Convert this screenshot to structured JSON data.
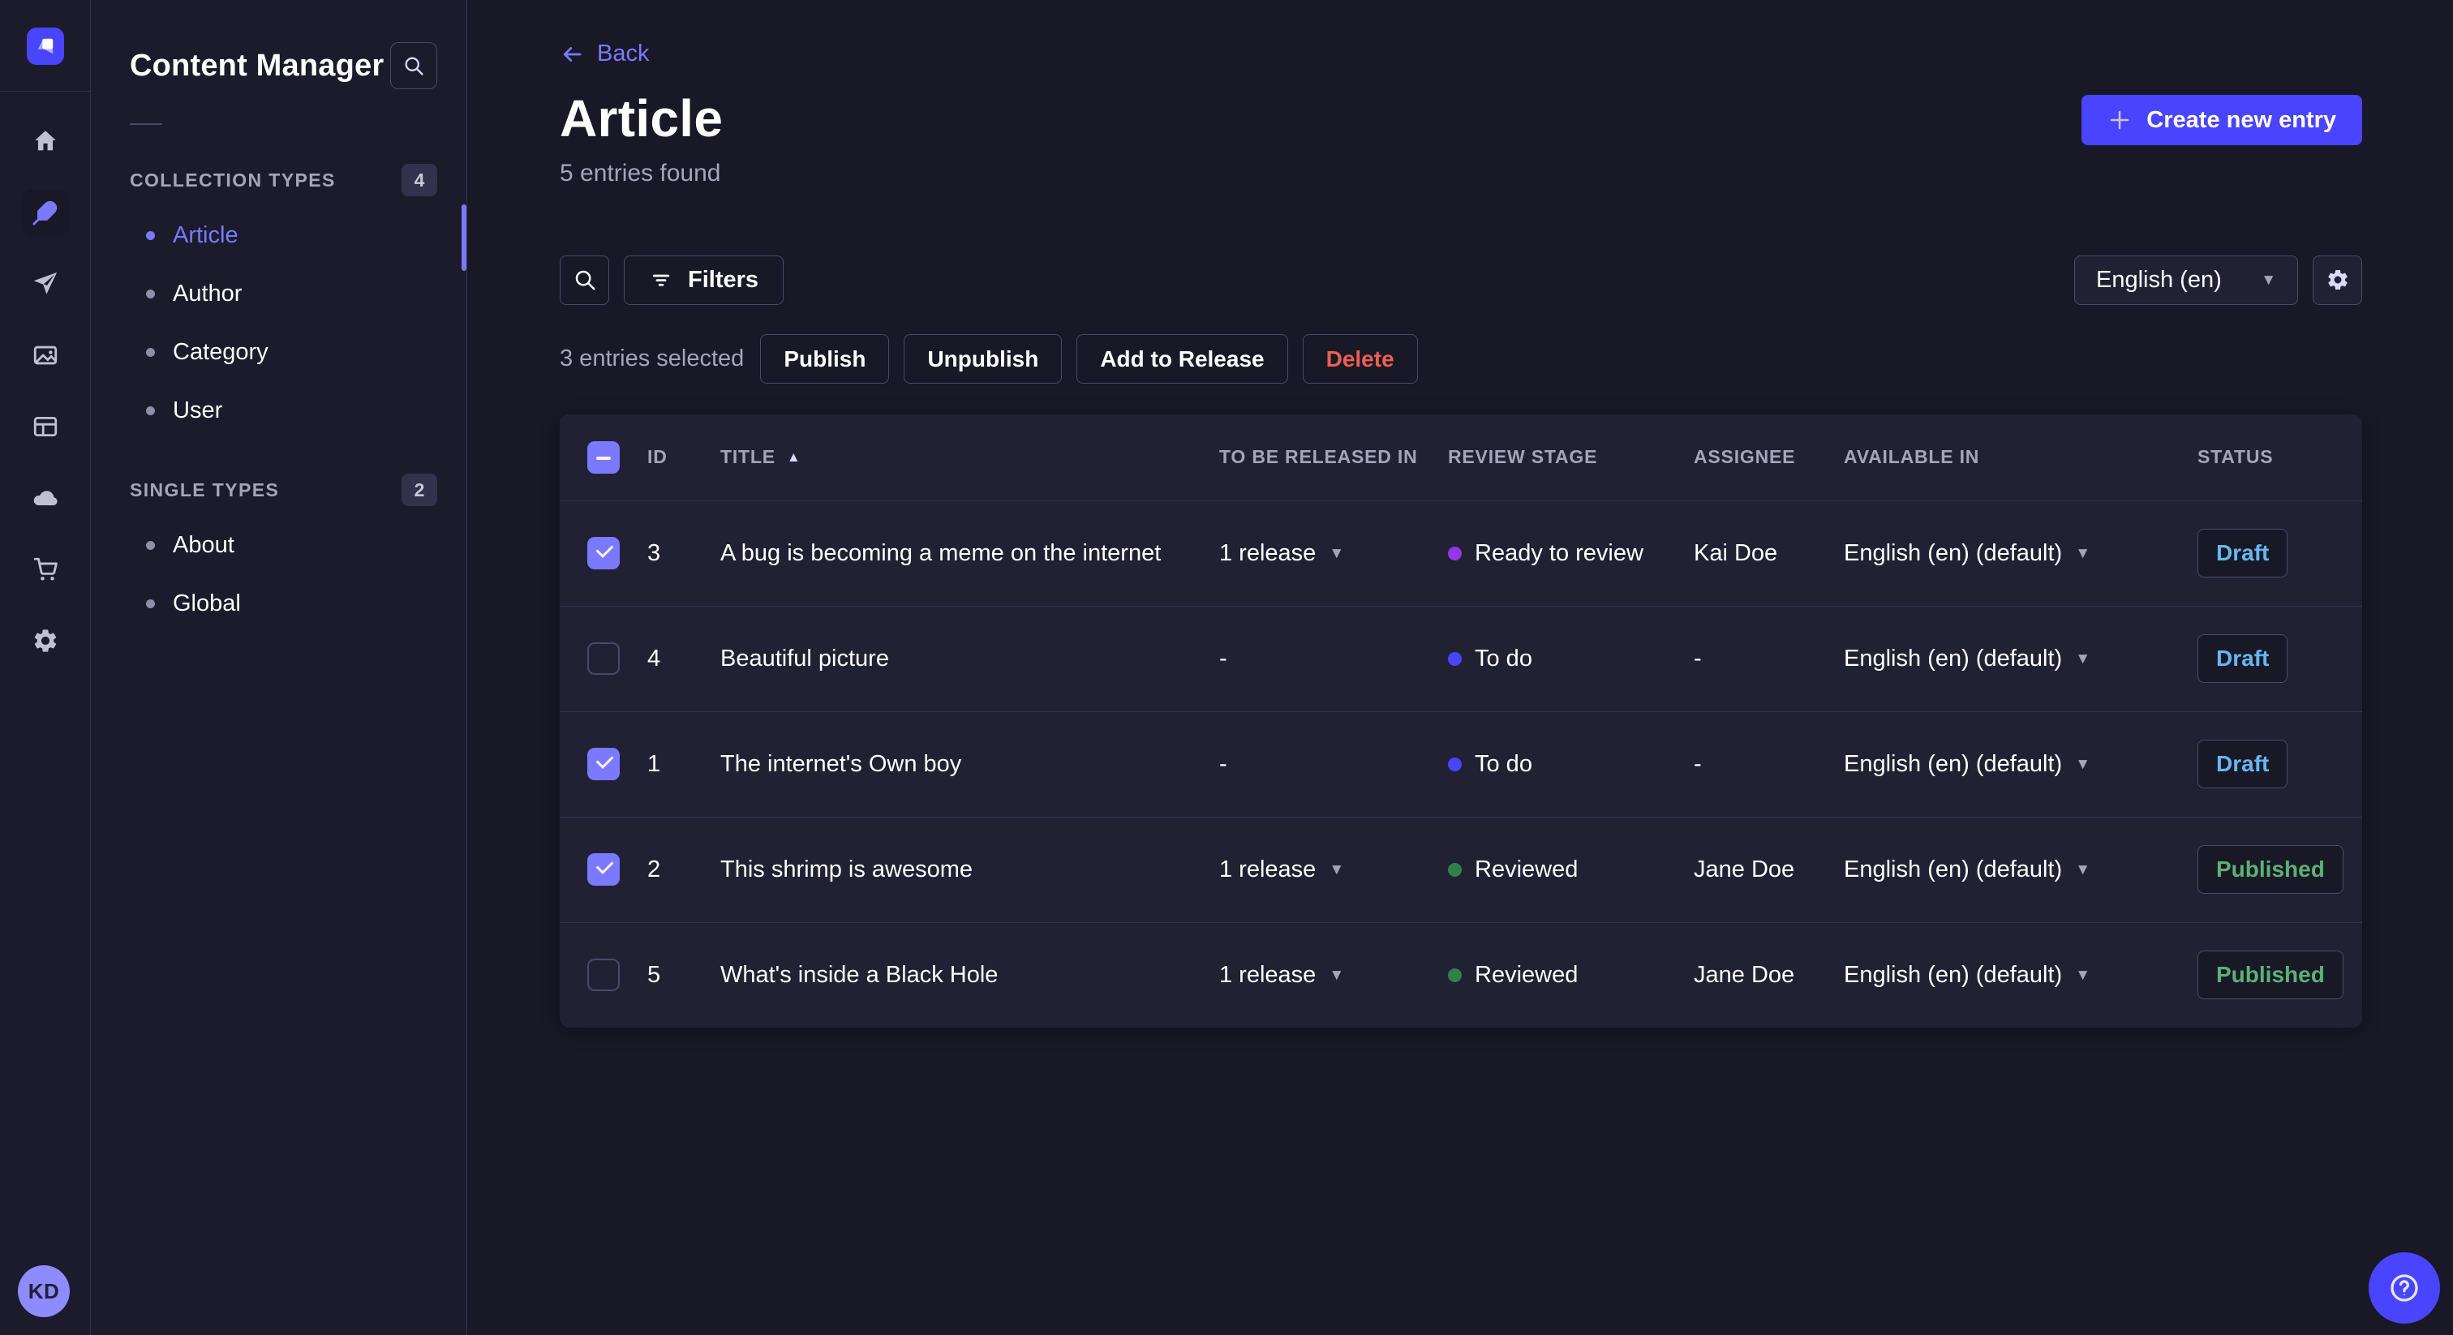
{
  "colors": {
    "bg": "#181826",
    "sidebar": "#1b1b2b",
    "surface": "#212134",
    "border": "#32324d",
    "border-light": "#4a4a6a",
    "text": "#ffffff",
    "muted": "#a5a5ba",
    "primary": "#4945ff",
    "primary-light": "#7b79ff",
    "danger": "#ee5e52",
    "draft": "#66b7f1",
    "published": "#5cb176"
  },
  "sidebar": {
    "app_title": "Content Manager",
    "sections": [
      {
        "label": "COLLECTION TYPES",
        "badge": "4",
        "items": [
          {
            "label": "Article"
          },
          {
            "label": "Author"
          },
          {
            "label": "Category"
          },
          {
            "label": "User"
          }
        ]
      },
      {
        "label": "SINGLE TYPES",
        "badge": "2",
        "items": [
          {
            "label": "About"
          },
          {
            "label": "Global"
          }
        ]
      }
    ],
    "avatar_initials": "KD"
  },
  "header": {
    "back": "Back",
    "title": "Article",
    "subtitle": "5 entries found",
    "create_button": "Create new entry"
  },
  "toolbar": {
    "filters_label": "Filters",
    "locale": "English (en)"
  },
  "selection": {
    "label": "3 entries selected",
    "publish": "Publish",
    "unpublish": "Unpublish",
    "add_to_release": "Add to Release",
    "delete": "Delete"
  },
  "table": {
    "headers": {
      "id": "ID",
      "title": "TITLE",
      "released": "TO BE RELEASED IN",
      "review": "REVIEW STAGE",
      "assignee": "ASSIGNEE",
      "available": "AVAILABLE IN",
      "status": "STATUS"
    },
    "sort_column": "TITLE",
    "rows": [
      {
        "checked": true,
        "id": "3",
        "title": "A bug is becoming a meme on the internet",
        "released": "1 release",
        "review": {
          "label": "Ready to review",
          "color": "#9736e8"
        },
        "assignee": "Kai Doe",
        "available": "English (en) (default)",
        "status": {
          "label": "Draft",
          "variant": "draft"
        }
      },
      {
        "checked": false,
        "id": "4",
        "title": "Beautiful picture",
        "released": "-",
        "review": {
          "label": "To do",
          "color": "#4945ff"
        },
        "assignee": "-",
        "available": "English (en) (default)",
        "status": {
          "label": "Draft",
          "variant": "draft"
        }
      },
      {
        "checked": true,
        "id": "1",
        "title": "The internet's Own boy",
        "released": "-",
        "review": {
          "label": "To do",
          "color": "#4945ff"
        },
        "assignee": "-",
        "available": "English (en) (default)",
        "status": {
          "label": "Draft",
          "variant": "draft"
        }
      },
      {
        "checked": true,
        "id": "2",
        "title": "This shrimp is awesome",
        "released": "1 release",
        "review": {
          "label": "Reviewed",
          "color": "#328048"
        },
        "assignee": "Jane Doe",
        "available": "English (en) (default)",
        "status": {
          "label": "Published",
          "variant": "published"
        }
      },
      {
        "checked": false,
        "id": "5",
        "title": "What's inside a Black Hole",
        "released": "1 release",
        "review": {
          "label": "Reviewed",
          "color": "#328048"
        },
        "assignee": "Jane Doe",
        "available": "English (en) (default)",
        "status": {
          "label": "Published",
          "variant": "published"
        }
      }
    ]
  }
}
